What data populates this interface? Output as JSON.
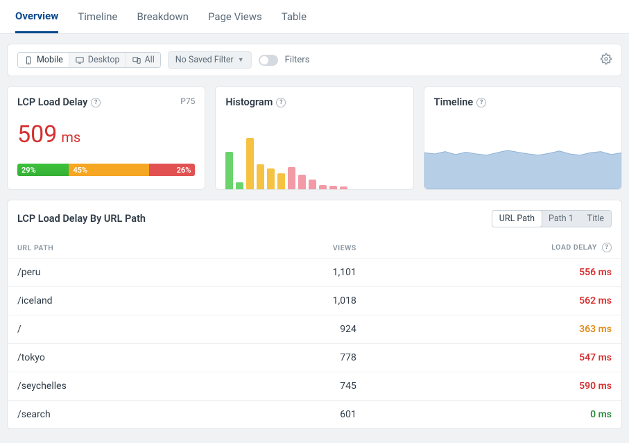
{
  "tabs": [
    "Overview",
    "Timeline",
    "Breakdown",
    "Page Views",
    "Table"
  ],
  "active_tab": 0,
  "filter_bar": {
    "devices": [
      {
        "label": "Mobile",
        "icon": "phone",
        "active": true
      },
      {
        "label": "Desktop",
        "icon": "desktop",
        "active": false
      },
      {
        "label": "All",
        "icon": "both",
        "active": false
      }
    ],
    "saved_filter_label": "No Saved Filter",
    "filters_label": "Filters"
  },
  "cards": {
    "lcp": {
      "title": "LCP Load Delay",
      "badge": "P75",
      "value": "509",
      "unit": "ms",
      "distribution": {
        "good": "29%",
        "needs": "45%",
        "poor": "26%"
      }
    },
    "histogram": {
      "title": "Histogram"
    },
    "timeline": {
      "title": "Timeline"
    }
  },
  "chart_data": [
    {
      "type": "bar",
      "title": "Histogram",
      "x": [
        0,
        1,
        2,
        3,
        4,
        5,
        6,
        7,
        8,
        9,
        10,
        11
      ],
      "series": [
        {
          "name": "good",
          "color": "#6bd36b",
          "values": [
            54,
            10,
            0,
            0,
            0,
            0,
            0,
            0,
            0,
            0,
            0,
            0
          ]
        },
        {
          "name": "needs",
          "color": "#f5c242",
          "values": [
            0,
            0,
            74,
            36,
            30,
            23,
            0,
            0,
            0,
            0,
            0,
            0
          ]
        },
        {
          "name": "poor",
          "color": "#f29aa6",
          "values": [
            0,
            0,
            0,
            0,
            0,
            0,
            32,
            21,
            14,
            6,
            5,
            4
          ]
        }
      ],
      "ylim": [
        0,
        80
      ],
      "xlabel": "",
      "ylabel": ""
    },
    {
      "type": "area",
      "title": "Timeline",
      "x": [
        0,
        1,
        2,
        3,
        4,
        5,
        6,
        7,
        8,
        9,
        10,
        11,
        12,
        13,
        14,
        15,
        16,
        17,
        18,
        19
      ],
      "values": [
        62,
        60,
        64,
        59,
        63,
        60,
        58,
        62,
        66,
        63,
        60,
        58,
        61,
        65,
        60,
        58,
        62,
        64,
        59,
        62
      ],
      "ylim": [
        0,
        100
      ],
      "color": "#b6cfe7"
    }
  ],
  "table": {
    "title": "LCP Load Delay By URL Path",
    "scope_tabs": [
      "URL Path",
      "Path 1",
      "Title"
    ],
    "scope_active": 0,
    "columns": {
      "path": "URL PATH",
      "views": "VIEWS",
      "delay": "LOAD DELAY"
    },
    "rows": [
      {
        "path": "/peru",
        "views": "1,101",
        "delay": "556 ms",
        "tone": "red"
      },
      {
        "path": "/iceland",
        "views": "1,018",
        "delay": "562 ms",
        "tone": "red"
      },
      {
        "path": "/",
        "views": "924",
        "delay": "363 ms",
        "tone": "orange"
      },
      {
        "path": "/tokyo",
        "views": "778",
        "delay": "547 ms",
        "tone": "red"
      },
      {
        "path": "/seychelles",
        "views": "745",
        "delay": "590 ms",
        "tone": "red"
      },
      {
        "path": "/search",
        "views": "601",
        "delay": "0 ms",
        "tone": "green"
      }
    ]
  }
}
